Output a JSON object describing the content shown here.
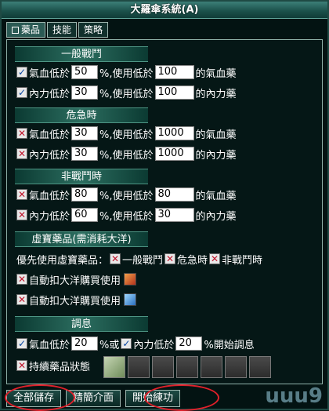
{
  "window": {
    "title": "大羅傘系統(A)"
  },
  "tabs": [
    {
      "label": "藥品",
      "active": true
    },
    {
      "label": "技能",
      "active": false
    },
    {
      "label": "策略",
      "active": false
    }
  ],
  "combat": {
    "header": "一般戰鬥",
    "hp": {
      "prefix": "氣血低於",
      "percent": "50",
      "mid": "%,使用低於",
      "amount": "100",
      "suffix": "的氣血藥",
      "checked": true
    },
    "mp": {
      "prefix": "內力低於",
      "percent": "30",
      "mid": "%,使用低於",
      "amount": "100",
      "suffix": "的內力藥",
      "checked": true
    }
  },
  "danger": {
    "header": "危急時",
    "hp": {
      "prefix": "氣血低於",
      "percent": "30",
      "mid": "%,使用低於",
      "amount": "1000",
      "suffix": "的氣血藥",
      "checked": false
    },
    "mp": {
      "prefix": "內力低於",
      "percent": "30",
      "mid": "%,使用低於",
      "amount": "1000",
      "suffix": "的內力藥",
      "checked": false
    }
  },
  "noncombat": {
    "header": "非戰鬥時",
    "hp": {
      "prefix": "氣血低於",
      "percent": "80",
      "mid": "%,使用低於",
      "amount": "80",
      "suffix": "的氣血藥",
      "checked": false
    },
    "mp": {
      "prefix": "內力低於",
      "percent": "60",
      "mid": "%,使用低於",
      "amount": "30",
      "suffix": "的內力藥",
      "checked": false
    }
  },
  "treasure": {
    "header": "虛寶藥品(需消耗大洋)",
    "priority_label": "優先使用虛寶藥品：",
    "opt_combat": "一般戰鬥",
    "opt_danger": "危急時",
    "opt_noncombat": "非戰鬥時",
    "auto1": "自動扣大洋購買使用",
    "auto2": "自動扣大洋購買使用"
  },
  "rest": {
    "header": "調息",
    "hp_prefix": "氣血低於",
    "hp_percent": "20",
    "or_label": "%或",
    "mp_prefix": "內力低於",
    "mp_percent": "20",
    "end_label": "%開始調息",
    "keep_label": "持續藥品狀態"
  },
  "buttons": {
    "save_all": "全部儲存",
    "simplify": "精簡介面",
    "start": "開始練功"
  },
  "watermark": "uuu9"
}
